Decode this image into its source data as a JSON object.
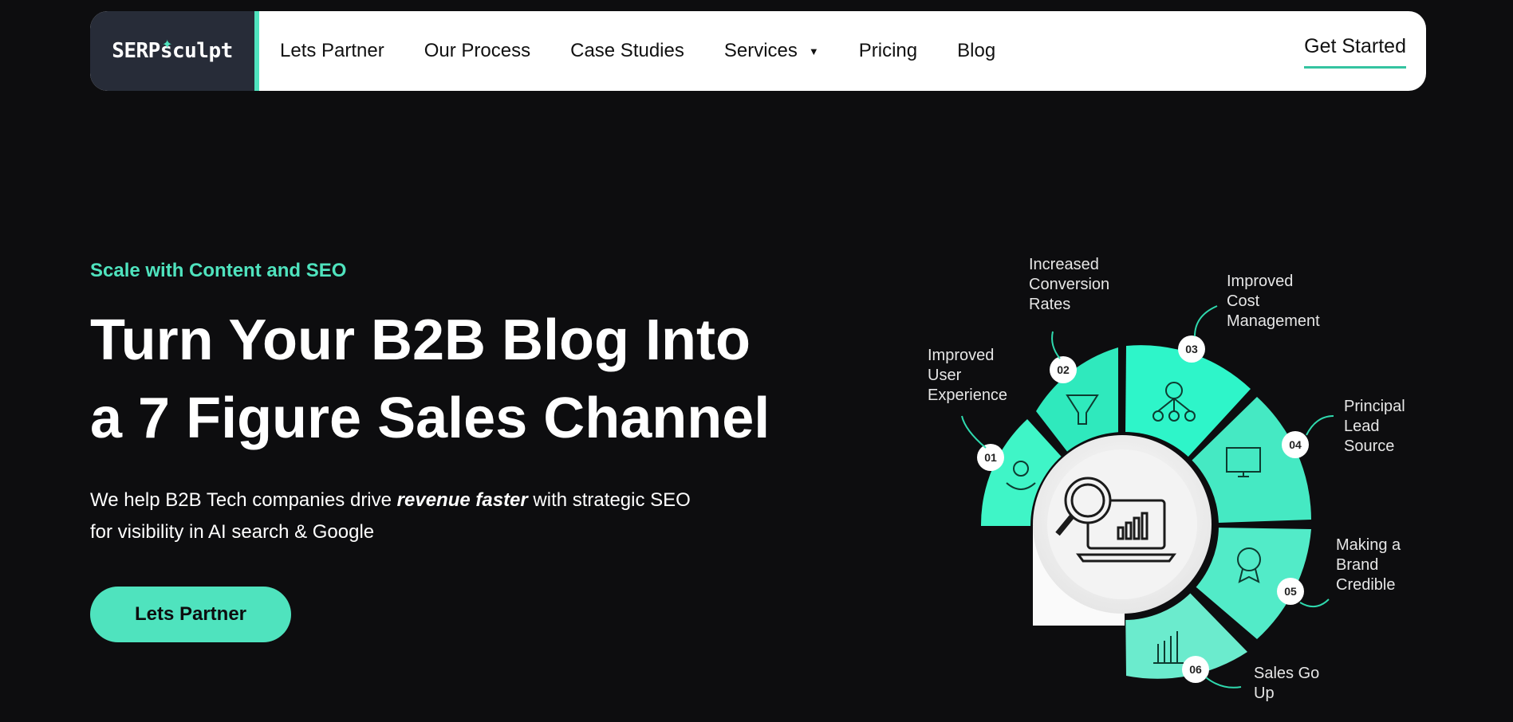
{
  "brand": {
    "logo_text": "SERPsculpt"
  },
  "nav": {
    "links": [
      "Lets Partner",
      "Our Process",
      "Case Studies",
      "Services",
      "Pricing",
      "Blog"
    ],
    "cta": "Get Started"
  },
  "hero": {
    "eyebrow": "Scale with Content and SEO",
    "headline_line1": "Turn Your B2B Blog Into",
    "headline_line2": "a 7 Figure Sales Channel",
    "sub_before": "We help B2B Tech companies drive ",
    "sub_emphasis": "revenue faster",
    "sub_after": " with strategic SEO for visibility in AI search & Google",
    "button": "Lets Partner"
  },
  "infographic": {
    "steps": [
      {
        "num": "01",
        "label": [
          "Improved",
          "User",
          "Experience"
        ],
        "icon": "hands-user-icon"
      },
      {
        "num": "02",
        "label": [
          "Increased",
          "Conversion",
          "Rates"
        ],
        "icon": "funnel-icon"
      },
      {
        "num": "03",
        "label": [
          "Improved",
          "Cost",
          "Management"
        ],
        "icon": "money-network-icon"
      },
      {
        "num": "04",
        "label": [
          "Principal",
          "Lead",
          "Source"
        ],
        "icon": "monitor-megaphone-icon"
      },
      {
        "num": "05",
        "label": [
          "Making a",
          "Brand",
          "Credible"
        ],
        "icon": "award-badge-icon"
      },
      {
        "num": "06",
        "label": [
          "Sales Go",
          "Up"
        ],
        "icon": "growth-chart-icon"
      }
    ],
    "center_icon": "laptop-magnifier-icon",
    "accent": "#4fe3be"
  }
}
